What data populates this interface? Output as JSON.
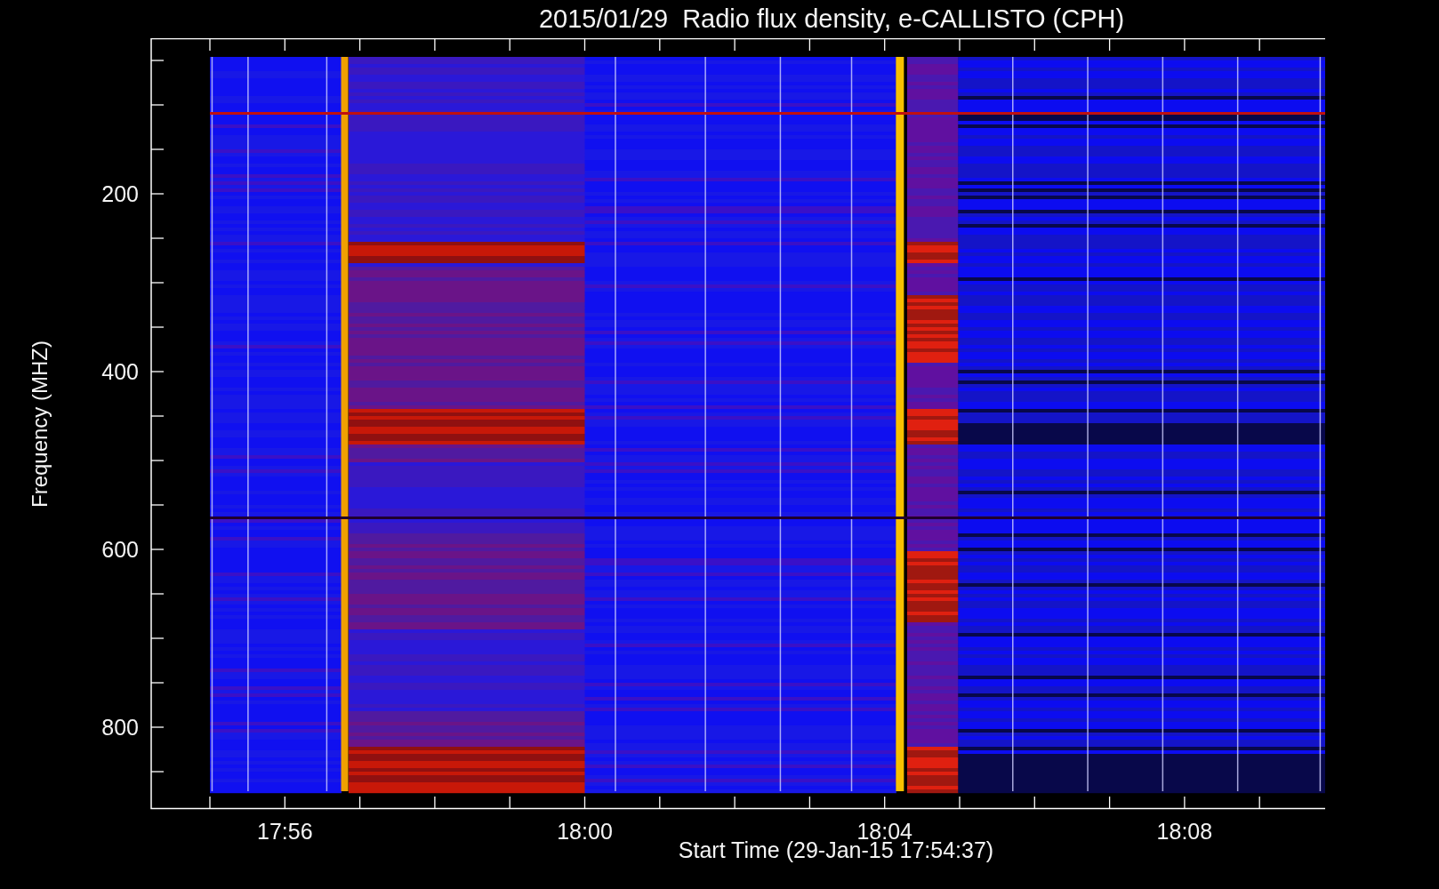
{
  "plot": {
    "title": "2015/01/29  Radio flux density, e-CALLISTO (CPH)",
    "ylabel": "Frequency (MHZ)",
    "xlabel": "Start Time (29-Jan-15 17:54:37)",
    "yticks": [
      "200",
      "400",
      "600",
      "800"
    ],
    "xticks": [
      "17:56",
      "18:00",
      "18:04",
      "18:08"
    ]
  }
}
